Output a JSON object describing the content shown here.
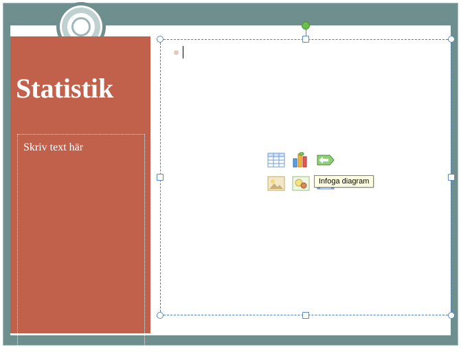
{
  "slide": {
    "title": "Statistik",
    "text_placeholder": "Skriv text här"
  },
  "content_placeholder": {
    "tooltip": "Infoga diagram",
    "icons": {
      "table": "insert-table",
      "chart": "insert-chart",
      "smartart": "insert-smartart",
      "picture": "insert-picture",
      "clipart": "insert-clipart",
      "media": "insert-media"
    }
  }
}
